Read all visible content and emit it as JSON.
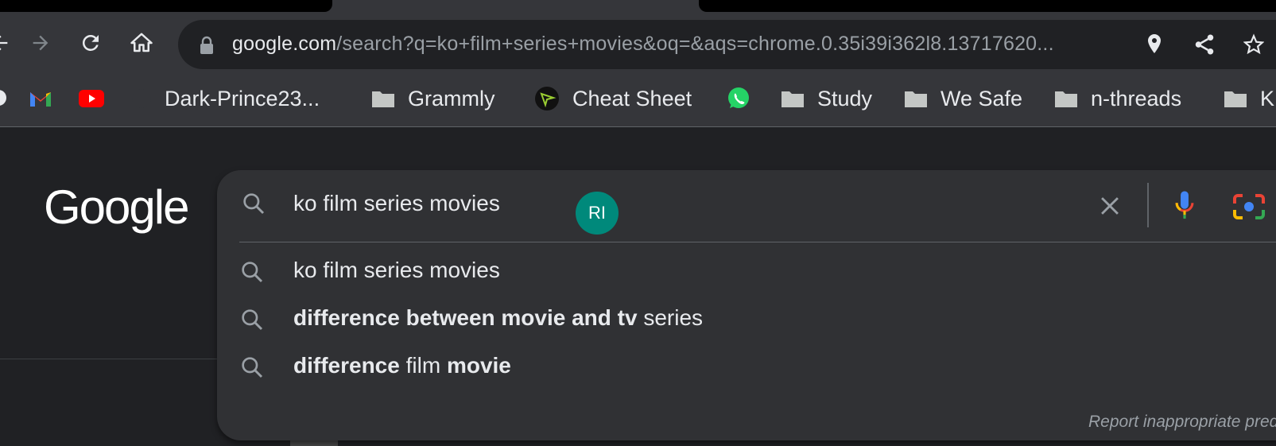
{
  "browser": {
    "url_host": "google.com",
    "url_path": "/search?q=ko+film+series+movies&oq=&aqs=chrome.0.35i39i362l8.13717620..."
  },
  "bookmarks": [
    {
      "label": "",
      "icon": "gmail-icon"
    },
    {
      "label": "",
      "icon": "youtube-icon"
    },
    {
      "label": "Dark-Prince23...",
      "icon": "github-icon"
    },
    {
      "label": "Grammly",
      "icon": "folder-icon"
    },
    {
      "label": "Cheat Sheet",
      "icon": "cheatsheet-icon"
    },
    {
      "label": "",
      "icon": "whatsapp-icon"
    },
    {
      "label": "Study",
      "icon": "folder-icon"
    },
    {
      "label": "We Safe",
      "icon": "folder-icon"
    },
    {
      "label": "n-threads",
      "icon": "folder-icon"
    },
    {
      "label": "K",
      "icon": "folder-icon"
    }
  ],
  "google": {
    "logo": "Google",
    "query": "ko film series movies",
    "avatar_initials": "RI",
    "suggestions": [
      {
        "parts": [
          {
            "text": "ko film series movies",
            "bold": false
          }
        ]
      },
      {
        "parts": [
          {
            "text": "difference between movie and tv",
            "bold": true
          },
          {
            "text": " series",
            "bold": false
          }
        ]
      },
      {
        "parts": [
          {
            "text": "difference",
            "bold": true
          },
          {
            "text": " film ",
            "bold": false
          },
          {
            "text": "movie",
            "bold": true
          }
        ]
      }
    ],
    "report_text": "Report inappropriate predictions"
  },
  "colors": {
    "avatar": "#00897b",
    "toolbar": "#35363a",
    "page_bg": "#202124",
    "searchbox_bg": "#303134"
  }
}
